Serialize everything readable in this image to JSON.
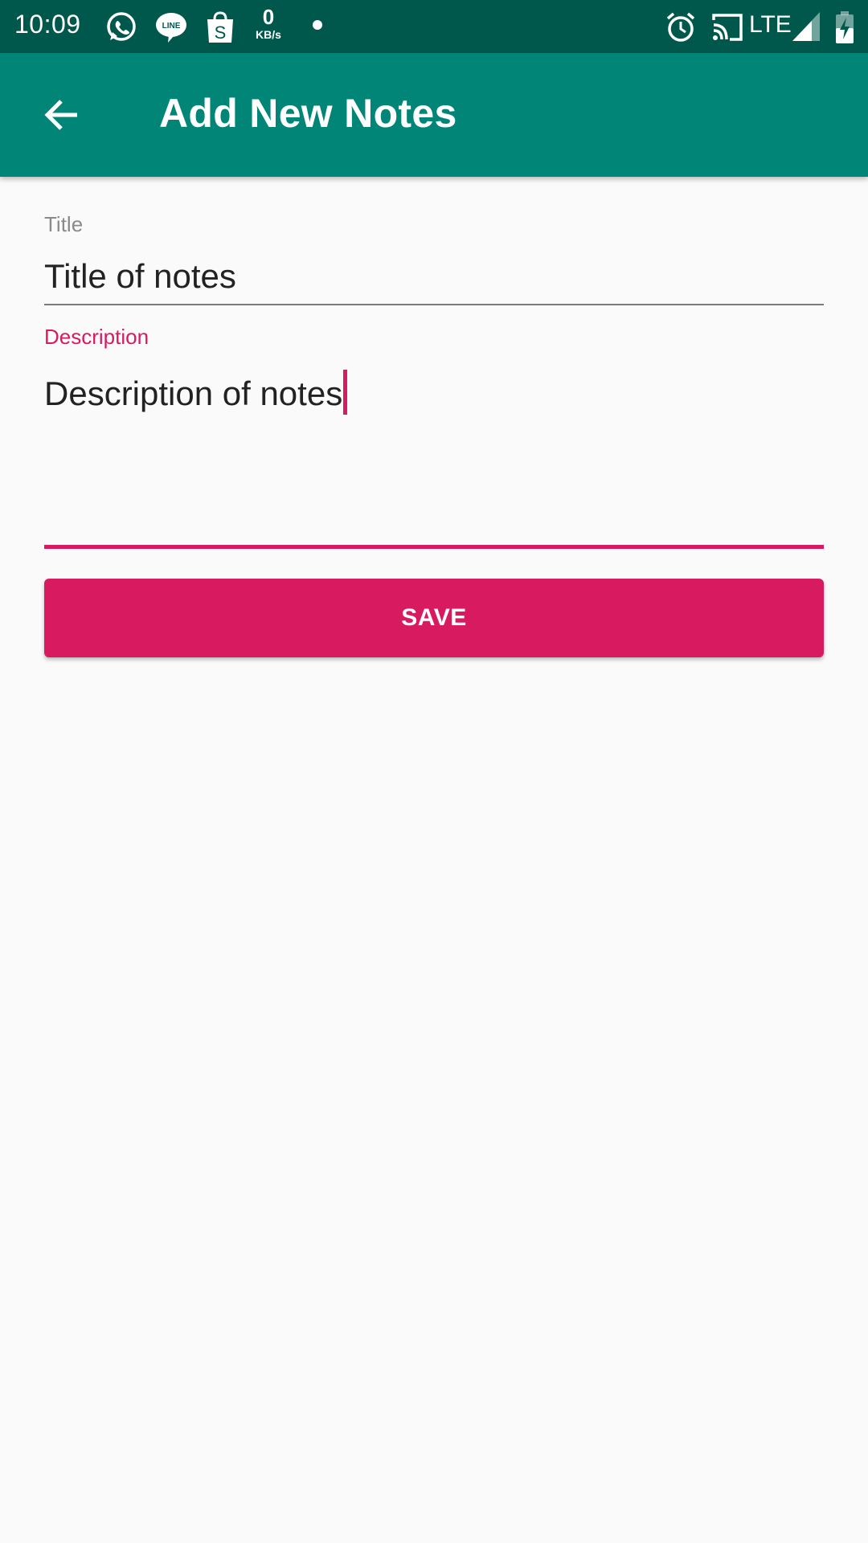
{
  "status_bar": {
    "time": "10:09",
    "speed_value": "0",
    "speed_unit": "KB/s",
    "network": "LTE",
    "icons": [
      "whatsapp-icon",
      "line-icon",
      "shopee-icon",
      "dot-icon",
      "alarm-icon",
      "cast-icon",
      "signal-icon",
      "battery-charging-icon"
    ]
  },
  "app_bar": {
    "title": "Add New Notes",
    "back_icon": "arrow-left-icon",
    "color": "#008577"
  },
  "form": {
    "title_label": "Title",
    "title_value": "Title of notes",
    "description_label": "Description",
    "description_value": "Description of notes",
    "accent_color": "#d81b60"
  },
  "actions": {
    "save_label": "SAVE"
  }
}
